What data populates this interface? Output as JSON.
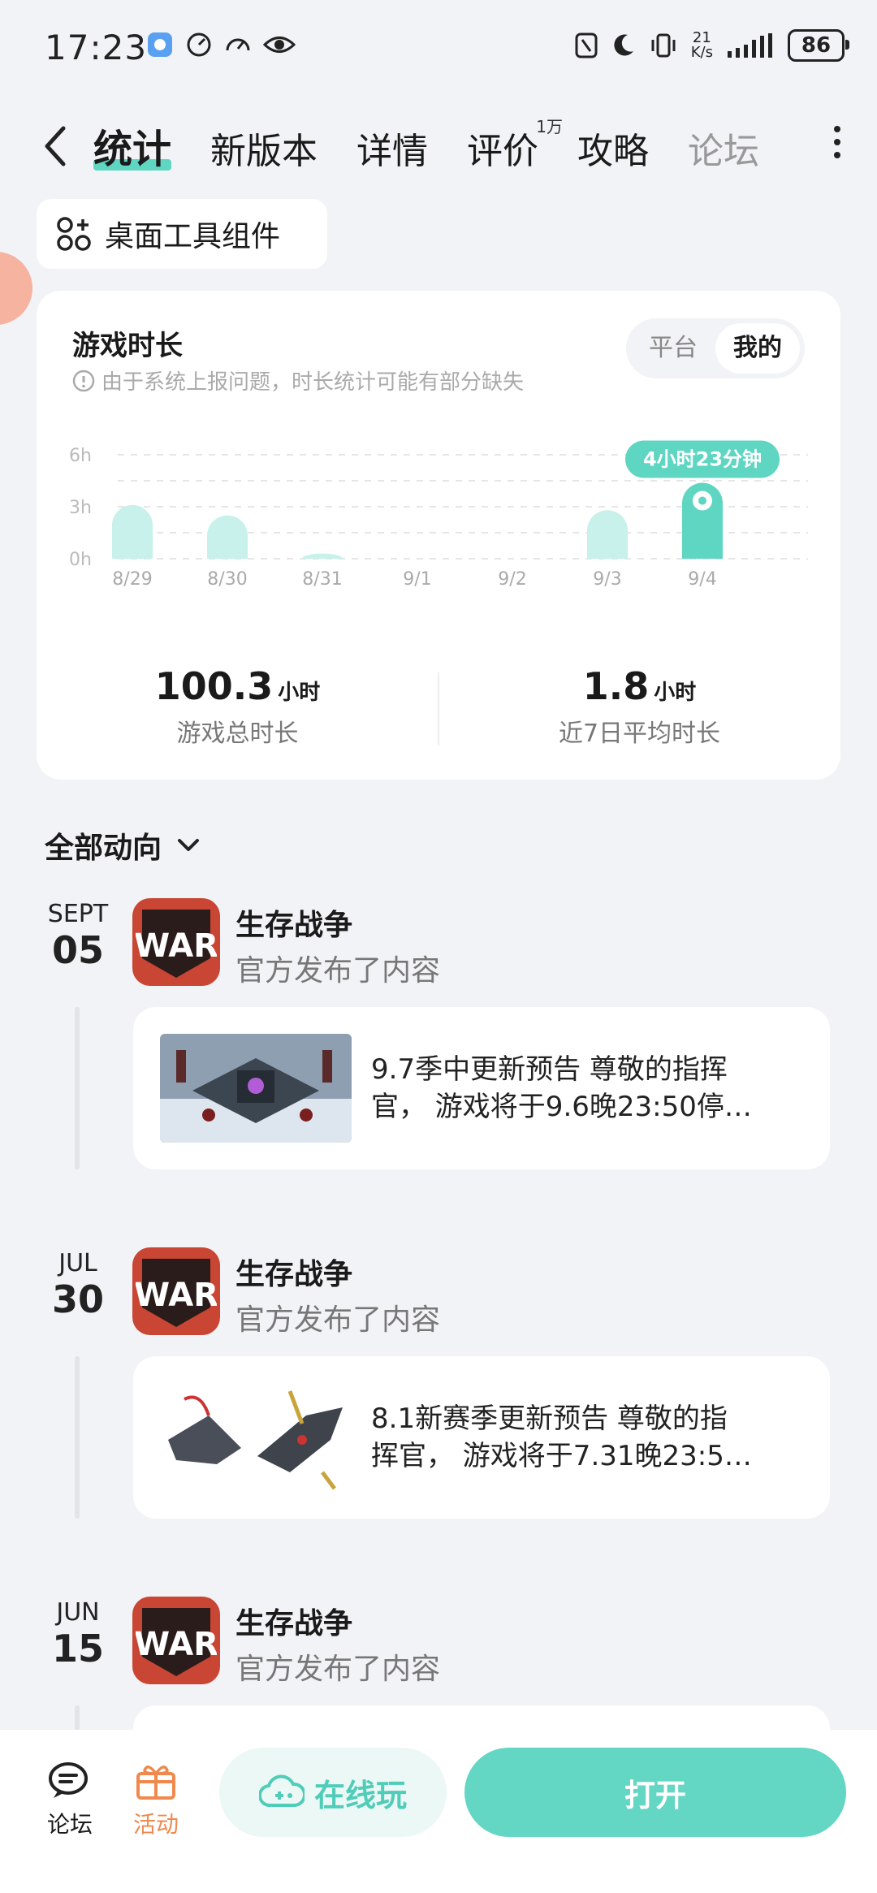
{
  "status_bar": {
    "time": "17:23",
    "net_speed_value": "21",
    "net_speed_unit": "K/s",
    "battery": "86"
  },
  "tabs": [
    {
      "label": "统计"
    },
    {
      "label": "新版本"
    },
    {
      "label": "详情"
    },
    {
      "label": "评价",
      "badge": "1万"
    },
    {
      "label": "攻略"
    },
    {
      "label": "论坛"
    }
  ],
  "widget_button": {
    "label": "桌面工具组件"
  },
  "stats": {
    "title": "游戏时长",
    "note": "由于系统上报问题，时长统计可能有部分缺失",
    "toggle": {
      "options": [
        "平台",
        "我的"
      ],
      "selected": "我的"
    },
    "total": {
      "value": "100.3",
      "unit": "小时",
      "label": "游戏总时长"
    },
    "avg": {
      "value": "1.8",
      "unit": "小时",
      "label": "近7日平均时长"
    }
  },
  "chart_data": {
    "type": "bar",
    "categories": [
      "8/29",
      "8/30",
      "8/31",
      "9/1",
      "9/2",
      "9/3",
      "9/4"
    ],
    "values": [
      3.1,
      2.5,
      0.3,
      0,
      0,
      2.8,
      4.38
    ],
    "ylim": [
      0,
      6
    ],
    "y_ticks": [
      "0h",
      "3h",
      "6h"
    ],
    "highlight_index": 6,
    "highlight_label": "4小时23分钟",
    "grid": true
  },
  "feed": {
    "filter_label": "全部动向",
    "items": [
      {
        "month": "SEPT",
        "day": "05",
        "app": "生存战争",
        "sub": "官方发布了内容",
        "line1": "9.7季中更新预告 尊敬的指挥",
        "line2": "官， 游戏将于9.6晚23:50停…"
      },
      {
        "month": "JUL",
        "day": "30",
        "app": "生存战争",
        "sub": "官方发布了内容",
        "line1": "8.1新赛季更新预告 尊敬的指",
        "line2": "挥官， 游戏将于7.31晚23:5…"
      },
      {
        "month": "JUN",
        "day": "15",
        "app": "生存战争",
        "sub": "官方发布了内容"
      }
    ]
  },
  "bottom": {
    "forum": "论坛",
    "activity": "活动",
    "online": "在线玩",
    "open": "打开"
  },
  "colors": {
    "accent": "#5ED6C2",
    "bar_light": "#C7F1EA",
    "activity": "#F0894E",
    "app_icon": "#C94534"
  }
}
